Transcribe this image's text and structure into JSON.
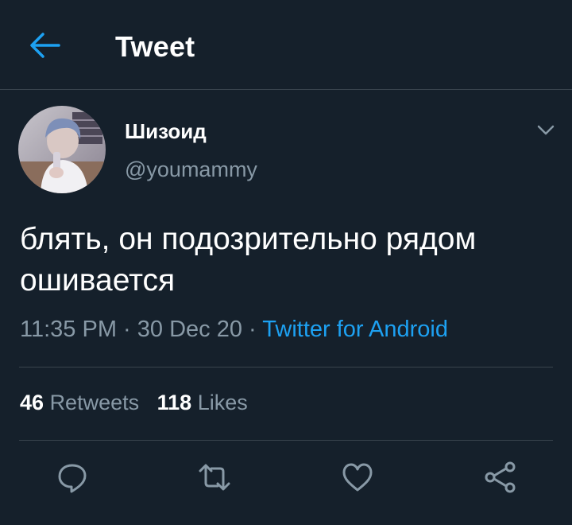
{
  "header": {
    "title": "Tweet",
    "back_icon": "arrow-left-icon"
  },
  "colors": {
    "background": "#15202b",
    "accent": "#1da1f2",
    "secondary_text": "#8899a6",
    "divider": "#38444d"
  },
  "tweet": {
    "author": {
      "display_name": "Шизоид",
      "handle": "@youmammy"
    },
    "text_line_1": "блять, он подозрительно рядом",
    "text_line_2": "ошивается",
    "time": "11:35 PM",
    "separator": "·",
    "date": "30 Dec 20",
    "source": "Twitter for Android",
    "stats": {
      "retweets_count": "46",
      "retweets_label": "Retweets",
      "likes_count": "118",
      "likes_label": "Likes"
    }
  },
  "actions": [
    {
      "icon": "reply-icon"
    },
    {
      "icon": "retweet-icon"
    },
    {
      "icon": "like-icon"
    },
    {
      "icon": "share-icon"
    }
  ]
}
